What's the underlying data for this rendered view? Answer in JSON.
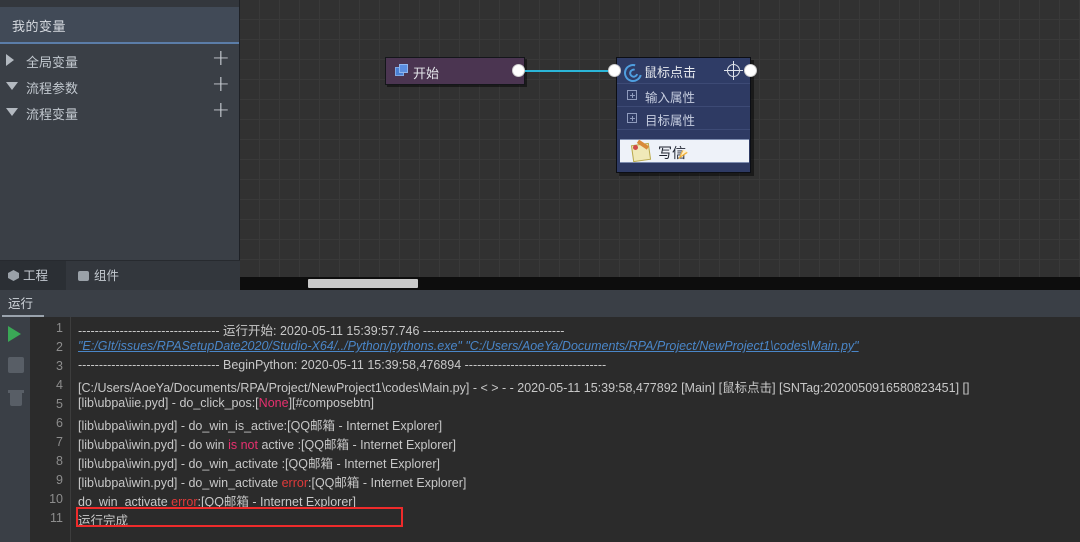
{
  "left_panel": {
    "variables_header": "我的变量",
    "tree": [
      {
        "label": "全局变量",
        "expanded": false,
        "add_label": "+"
      },
      {
        "label": "流程参数",
        "expanded": true,
        "add_label": "+"
      },
      {
        "label": "流程变量",
        "expanded": true,
        "add_label": "+"
      }
    ],
    "tabs": [
      {
        "label": "工程",
        "icon": "cube-icon",
        "active": true
      },
      {
        "label": "组件",
        "icon": "puzzle-icon",
        "active": false
      }
    ]
  },
  "canvas": {
    "nodes": [
      {
        "id": "start",
        "title": "开始",
        "icon": "copy-pages-icon"
      },
      {
        "id": "mouse-click",
        "title": "鼠标点击",
        "header_icon": "mouse-click-icon",
        "target_icon": "crosshair-icon",
        "rows": [
          {
            "label": "输入属性",
            "expander": "plus-box-icon"
          },
          {
            "label": "目标属性",
            "expander": "plus-box-icon"
          }
        ],
        "selected_item": {
          "label": "写信",
          "icon": "pencil-note-icon"
        }
      }
    ],
    "connection": {
      "from": "start",
      "to": "mouse-click",
      "color": "#2bb6d8"
    }
  },
  "run_panel": {
    "tab_label": "运行",
    "toolbar": [
      {
        "name": "run-button",
        "icon": "play-icon"
      },
      {
        "name": "stop-button",
        "icon": "stop-icon"
      },
      {
        "name": "clear-button",
        "icon": "trash-icon"
      }
    ],
    "log_lines": [
      {
        "num": "1",
        "segments": [
          {
            "text": "---------------------------------- 运行开始: 2020-05-11 15:39:57.746 ----------------------------------",
            "style": "normal"
          }
        ]
      },
      {
        "num": "2",
        "segments": [
          {
            "text": "\"E:/GIt/issues/RPASetupDate2020/Studio-X64/../Python/pythons.exe\"    \"C:/Users/AoeYa/Documents/RPA/Project/NewProject1\\codes\\Main.py\"",
            "style": "link"
          }
        ]
      },
      {
        "num": "3",
        "segments": [
          {
            "text": "---------------------------------- BeginPython: 2020-05-11 15:39:58,476894 ----------------------------------",
            "style": "normal"
          }
        ]
      },
      {
        "num": "4",
        "segments": [
          {
            "text": "[C:/Users/AoeYa/Documents/RPA/Project/NewProject1\\codes\\Main.py] - < > - - 2020-05-11 15:39:58,477892  [Main] [鼠标点击]  [SNTag:2020050916580823451]  []",
            "style": "normal"
          }
        ]
      },
      {
        "num": "5",
        "segments": [
          {
            "text": "[lib\\ubpa\\iie.pyd] - do_click_pos:[",
            "style": "normal"
          },
          {
            "text": "None",
            "style": "errpink"
          },
          {
            "text": "][#composebtn]",
            "style": "normal"
          }
        ]
      },
      {
        "num": "6",
        "segments": [
          {
            "text": "[lib\\ubpa\\iwin.pyd] - do_win_is_active:[QQ邮箱 - Internet Explorer]",
            "style": "normal"
          }
        ]
      },
      {
        "num": "7",
        "segments": [
          {
            "text": "[lib\\ubpa\\iwin.pyd] - do win ",
            "style": "normal"
          },
          {
            "text": "is not",
            "style": "errpink"
          },
          {
            "text": " active :[QQ邮箱 - Internet Explorer]",
            "style": "normal"
          }
        ]
      },
      {
        "num": "8",
        "segments": [
          {
            "text": "[lib\\ubpa\\iwin.pyd] - do_win_activate :[QQ邮箱 - Internet Explorer]",
            "style": "normal"
          }
        ]
      },
      {
        "num": "9",
        "segments": [
          {
            "text": "[lib\\ubpa\\iwin.pyd] - do_win_activate ",
            "style": "normal"
          },
          {
            "text": "error",
            "style": "err"
          },
          {
            "text": ":[QQ邮箱 - Internet Explorer]",
            "style": "normal"
          }
        ]
      },
      {
        "num": "10",
        "highlighted": true,
        "segments": [
          {
            "text": "do_win_activate ",
            "style": "normal"
          },
          {
            "text": "error",
            "style": "err"
          },
          {
            "text": ":[QQ邮箱 - Internet Explorer]",
            "style": "normal"
          }
        ]
      },
      {
        "num": "11",
        "segments": [
          {
            "text": "运行完成",
            "style": "normal"
          }
        ]
      }
    ],
    "highlight_color": "#ef2b2b"
  }
}
